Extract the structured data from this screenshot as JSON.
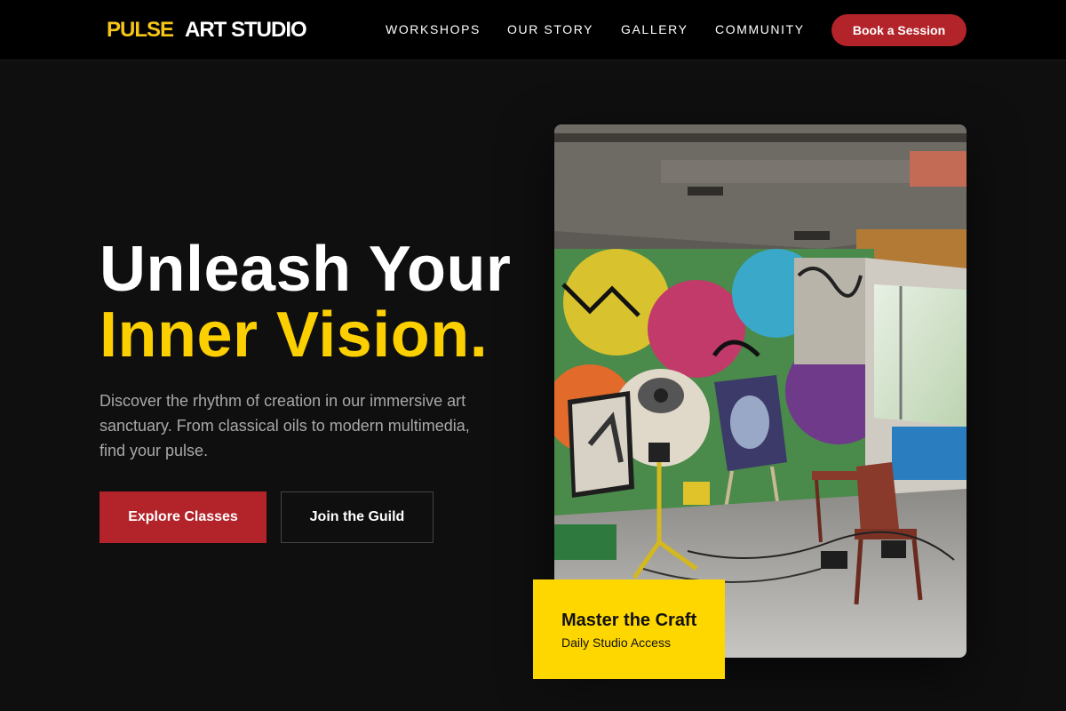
{
  "brand": {
    "accent": "PULSE",
    "name": "ART STUDIO"
  },
  "nav": {
    "links": [
      {
        "label": "WORKSHOPS"
      },
      {
        "label": "OUR STORY"
      },
      {
        "label": "GALLERY"
      },
      {
        "label": "COMMUNITY"
      }
    ],
    "cta": "Book a Session"
  },
  "hero": {
    "title_line1": "Unleash Your",
    "title_line2": "Inner Vision.",
    "description": "Discover the rhythm of creation in our immersive art sanctuary. From classical oils to modern multimedia, find your pulse.",
    "primary_button": "Explore Classes",
    "secondary_button": "Join the Guild"
  },
  "feature_card": {
    "title": "Master the Craft",
    "subtitle": "Daily Studio Access"
  },
  "colors": {
    "background": "#0f0f0f",
    "navbar": "#000000",
    "brand_yellow": "#f5c518",
    "headline_yellow": "#fcd000",
    "card_yellow": "#ffd700",
    "primary_red": "#b3232a",
    "muted_text": "#a8a8a8"
  },
  "image": {
    "subject": "studio-interior-photo"
  }
}
